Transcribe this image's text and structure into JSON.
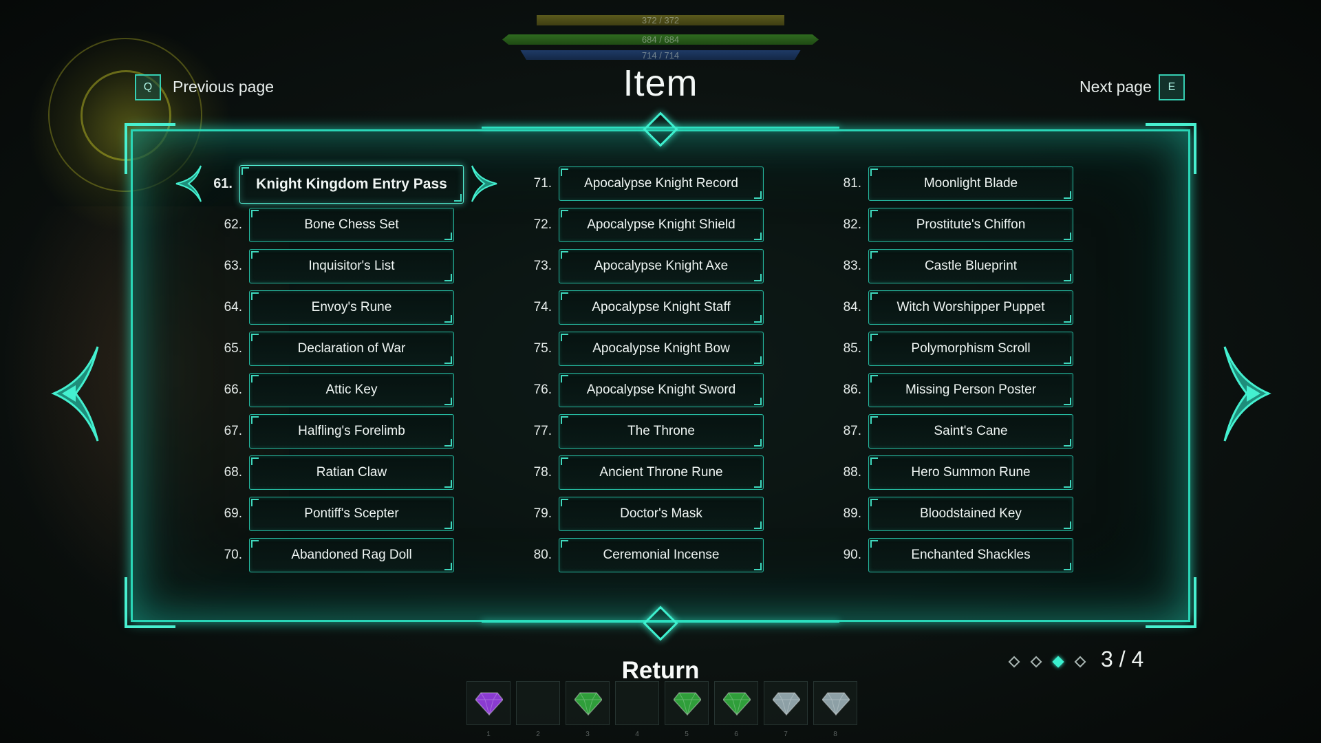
{
  "stats": {
    "hp": "372 / 372",
    "sp": "684 / 684",
    "mp": "714 / 714"
  },
  "nav": {
    "prev_key": "Q",
    "prev_label": "Previous page",
    "next_key": "E",
    "next_label": "Next page"
  },
  "title": "Item",
  "items": [
    {
      "num": "61.",
      "name": "Knight Kingdom Entry Pass"
    },
    {
      "num": "62.",
      "name": "Bone Chess Set"
    },
    {
      "num": "63.",
      "name": "Inquisitor's List"
    },
    {
      "num": "64.",
      "name": "Envoy's Rune"
    },
    {
      "num": "65.",
      "name": "Declaration of War"
    },
    {
      "num": "66.",
      "name": "Attic Key"
    },
    {
      "num": "67.",
      "name": "Halfling's Forelimb"
    },
    {
      "num": "68.",
      "name": "Ratian Claw"
    },
    {
      "num": "69.",
      "name": "Pontiff's Scepter"
    },
    {
      "num": "70.",
      "name": "Abandoned Rag Doll"
    },
    {
      "num": "71.",
      "name": "Apocalypse Knight Record"
    },
    {
      "num": "72.",
      "name": "Apocalypse Knight Shield"
    },
    {
      "num": "73.",
      "name": "Apocalypse Knight Axe"
    },
    {
      "num": "74.",
      "name": "Apocalypse Knight Staff"
    },
    {
      "num": "75.",
      "name": "Apocalypse Knight Bow"
    },
    {
      "num": "76.",
      "name": "Apocalypse Knight Sword"
    },
    {
      "num": "77.",
      "name": "The Throne"
    },
    {
      "num": "78.",
      "name": "Ancient Throne Rune"
    },
    {
      "num": "79.",
      "name": "Doctor's Mask"
    },
    {
      "num": "80.",
      "name": "Ceremonial Incense"
    },
    {
      "num": "81.",
      "name": "Moonlight Blade"
    },
    {
      "num": "82.",
      "name": "Prostitute's Chiffon"
    },
    {
      "num": "83.",
      "name": "Castle Blueprint"
    },
    {
      "num": "84.",
      "name": "Witch Worshipper Puppet"
    },
    {
      "num": "85.",
      "name": "Polymorphism Scroll"
    },
    {
      "num": "86.",
      "name": "Missing Person Poster"
    },
    {
      "num": "87.",
      "name": "Saint's Cane"
    },
    {
      "num": "88.",
      "name": "Hero Summon Rune"
    },
    {
      "num": "89.",
      "name": "Bloodstained Key"
    },
    {
      "num": "90.",
      "name": "Enchanted Shackles"
    }
  ],
  "selected_item": "Knight Kingdom Entry Pass",
  "return_label": "Return",
  "pagination": {
    "current": 3,
    "total": 4,
    "indicator": "3 / 4"
  },
  "hotbar": [
    {
      "slot": "1",
      "icon": "purple-gem-icon",
      "color": "#8a3bd1"
    },
    {
      "slot": "2",
      "icon": "empty-slot",
      "color": ""
    },
    {
      "slot": "3",
      "icon": "green-gem-icon",
      "color": "#2f9e3a"
    },
    {
      "slot": "4",
      "icon": "empty-slot",
      "color": ""
    },
    {
      "slot": "5",
      "icon": "green-gem-icon",
      "color": "#2f9e3a"
    },
    {
      "slot": "6",
      "icon": "green-gem-icon",
      "color": "#2f9e3a"
    },
    {
      "slot": "7",
      "icon": "silver-gem-icon",
      "color": "#8da0a6"
    },
    {
      "slot": "8",
      "icon": "silver-gem-icon",
      "color": "#8da0a6"
    }
  ],
  "colors": {
    "accent": "#2ad6b7",
    "accent_bright": "#3bf0cf",
    "panel_bg": "#0a1a17"
  }
}
